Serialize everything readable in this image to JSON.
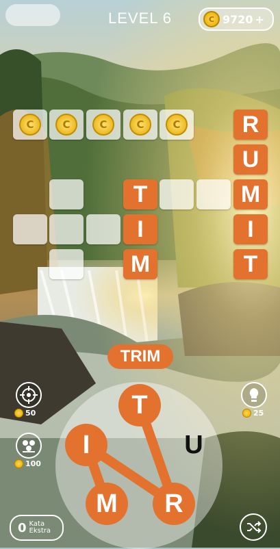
{
  "header": {
    "level_label": "LEVEL 6",
    "coins": "9720",
    "plus": "+"
  },
  "board": {
    "coin_tile_letter": "C",
    "trim_letters": [
      "T",
      "I",
      "M"
    ],
    "rumit_letters": [
      "R",
      "U",
      "M",
      "I",
      "T"
    ]
  },
  "current_word": "TRIM",
  "wheel": {
    "letters": [
      "T",
      "I",
      "U",
      "M",
      "R"
    ]
  },
  "powerups": {
    "target_price": "50",
    "multi_price": "100",
    "hint_price": "25"
  },
  "extra": {
    "count": "0",
    "label_line1": "Kata",
    "label_line2": "Ekstra"
  },
  "colors": {
    "accent": "#e2722e",
    "tile_empty": "#ffffffb8"
  }
}
